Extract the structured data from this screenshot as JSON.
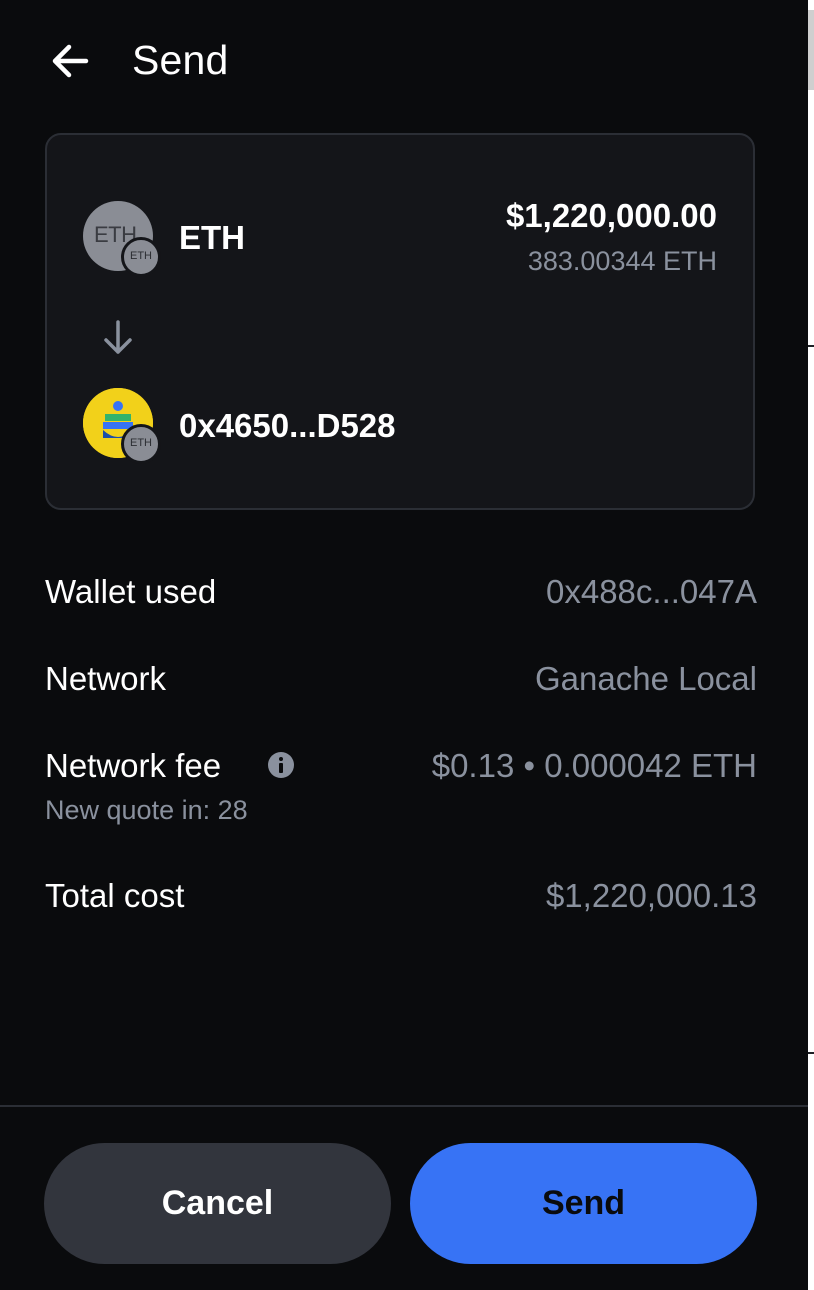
{
  "header": {
    "title": "Send",
    "back_icon": "arrow-left-icon"
  },
  "transfer": {
    "token": {
      "avatar_text": "ETH",
      "badge_text": "ETH",
      "name": "ETH",
      "fiat_amount": "$1,220,000.00",
      "crypto_amount": "383.00344 ETH"
    },
    "direction_icon": "arrow-down-icon",
    "recipient": {
      "badge_text": "ETH",
      "address": "0x4650...D528"
    }
  },
  "details": {
    "wallet_used": {
      "label": "Wallet used",
      "value": "0x488c...047A"
    },
    "network": {
      "label": "Network",
      "value": "Ganache Local"
    },
    "network_fee": {
      "label": "Network fee",
      "value": "$0.13 • 0.000042 ETH",
      "sub": "New quote in: 28",
      "info_icon": "info-icon"
    },
    "total_cost": {
      "label": "Total cost",
      "value": "$1,220,000.13"
    }
  },
  "actions": {
    "cancel_label": "Cancel",
    "send_label": "Send"
  },
  "colors": {
    "background": "#0a0b0d",
    "card": "#141519",
    "muted_text": "#8a919e",
    "primary": "#3773f5",
    "secondary_button": "#32353d",
    "recipient_avatar": "#f2d11a"
  }
}
